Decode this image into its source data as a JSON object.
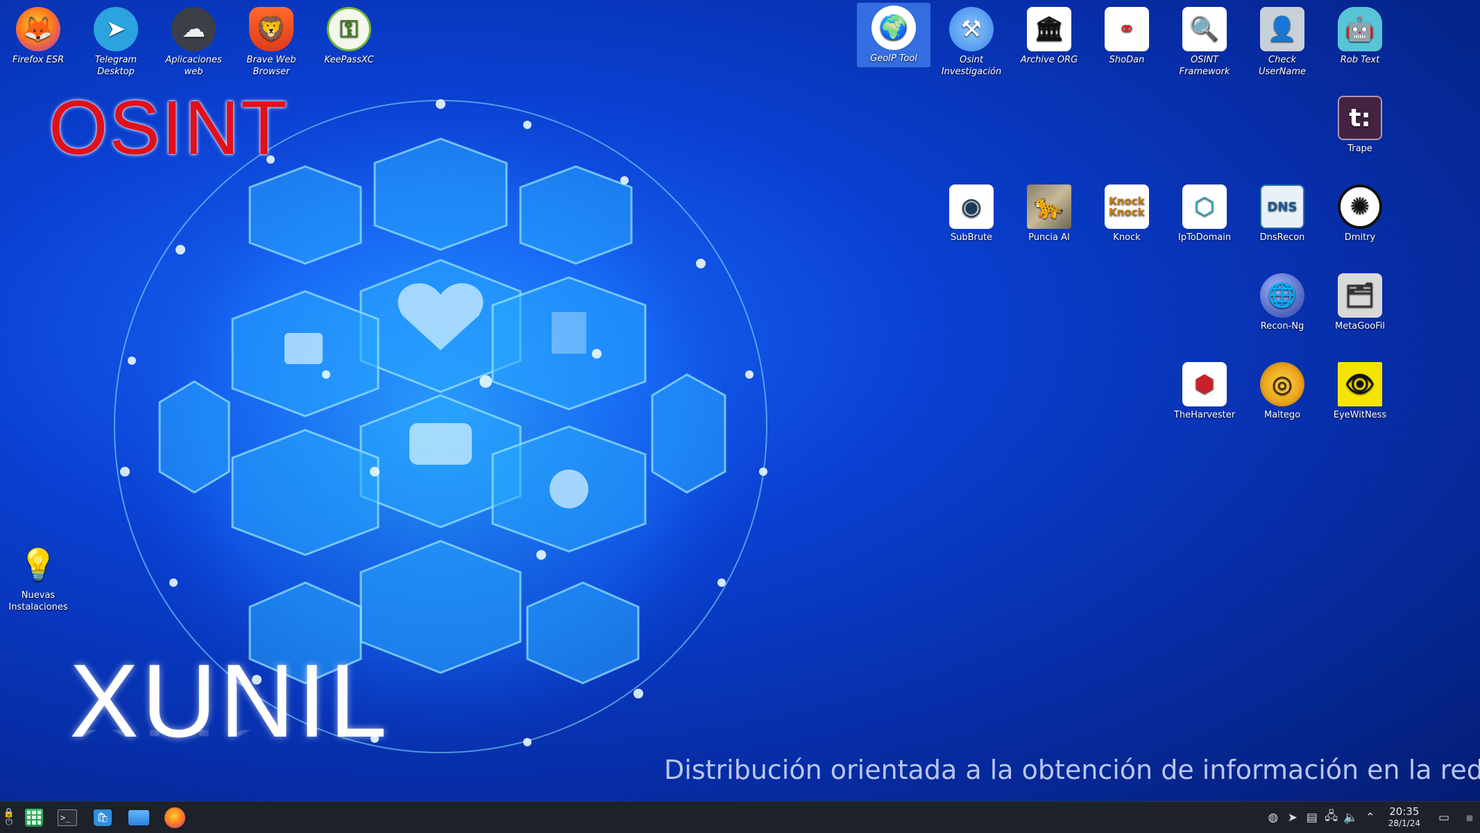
{
  "wallpaper": {
    "title_top": "OSINT",
    "title_bottom": "XUNIL",
    "tagline": "Distribución orientada a la obtención de información en la red"
  },
  "desktop_icons": [
    {
      "id": "firefox",
      "label": "Firefox ESR",
      "icon": "firefox-icon"
    },
    {
      "id": "telegram",
      "label": "Telegram Desktop",
      "icon": "telegram-icon"
    },
    {
      "id": "webapps",
      "label": "Aplicaciones web",
      "icon": "cloud-icon"
    },
    {
      "id": "brave",
      "label": "Brave Web Browser",
      "icon": "brave-lion-icon"
    },
    {
      "id": "keepassxc",
      "label": "KeePassXC",
      "icon": "key-icon"
    },
    {
      "id": "geoip",
      "label": "GeoIP Tool",
      "icon": "globe-pin-icon"
    },
    {
      "id": "osint-inv",
      "label": "Osint Investigación",
      "icon": "hammer-icon"
    },
    {
      "id": "archive",
      "label": "Archive ORG",
      "icon": "archive-building-icon"
    },
    {
      "id": "shodan",
      "label": "ShoDan",
      "icon": "shodan-icon"
    },
    {
      "id": "osint-fw",
      "label": "OSINT Framework",
      "icon": "network-magnifier-icon"
    },
    {
      "id": "checkuser",
      "label": "Check UserName",
      "icon": "user-check-icon"
    },
    {
      "id": "robtext",
      "label": "Rob Text",
      "icon": "robot-icon"
    },
    {
      "id": "trape",
      "label": "Trape",
      "icon": "trape-icon"
    },
    {
      "id": "subbrute",
      "label": "SubBrute",
      "icon": "eye-network-icon"
    },
    {
      "id": "puncia",
      "label": "Puncia AI",
      "icon": "leopard-icon"
    },
    {
      "id": "knock",
      "label": "Knock",
      "icon": "knock-icon"
    },
    {
      "id": "iptodomain",
      "label": "IpToDomain",
      "icon": "cube-icon"
    },
    {
      "id": "dnsrecon",
      "label": "DnsRecon",
      "icon": "dns-icon"
    },
    {
      "id": "dmitry",
      "label": "Dmitry",
      "icon": "spider-icon"
    },
    {
      "id": "reconng",
      "label": "Recon-Ng",
      "icon": "recon-globe-icon"
    },
    {
      "id": "metagoofil",
      "label": "MetaGooFil",
      "icon": "documents-icon"
    },
    {
      "id": "theharvester",
      "label": "TheHarvester",
      "icon": "harvester-icon"
    },
    {
      "id": "maltego",
      "label": "Maltego",
      "icon": "maltego-icon"
    },
    {
      "id": "eyewitness",
      "label": "EyeWitNess",
      "icon": "eye-icon"
    },
    {
      "id": "nuevas",
      "label": "Nuevas Instalaciones",
      "icon": "lightbulb-icon"
    }
  ],
  "taskbar": {
    "apps": [
      {
        "name": "app-launcher",
        "icon": "app-grid-icon"
      },
      {
        "name": "terminal",
        "icon": "terminal-icon"
      },
      {
        "name": "software-store",
        "icon": "bag-icon"
      },
      {
        "name": "file-manager",
        "icon": "folder-icon"
      },
      {
        "name": "firefox",
        "icon": "firefox-icon"
      }
    ],
    "tray": [
      "vpn-icon",
      "telegram-icon",
      "clipboard-icon",
      "network-icon",
      "volume-icon",
      "chevron-up-icon"
    ],
    "time": "20:35",
    "date": "28/1/24"
  },
  "colors": {
    "osint_red": "#e0101c",
    "selection_blue": "#3c78e6",
    "taskbar_bg": "#1d2129"
  }
}
